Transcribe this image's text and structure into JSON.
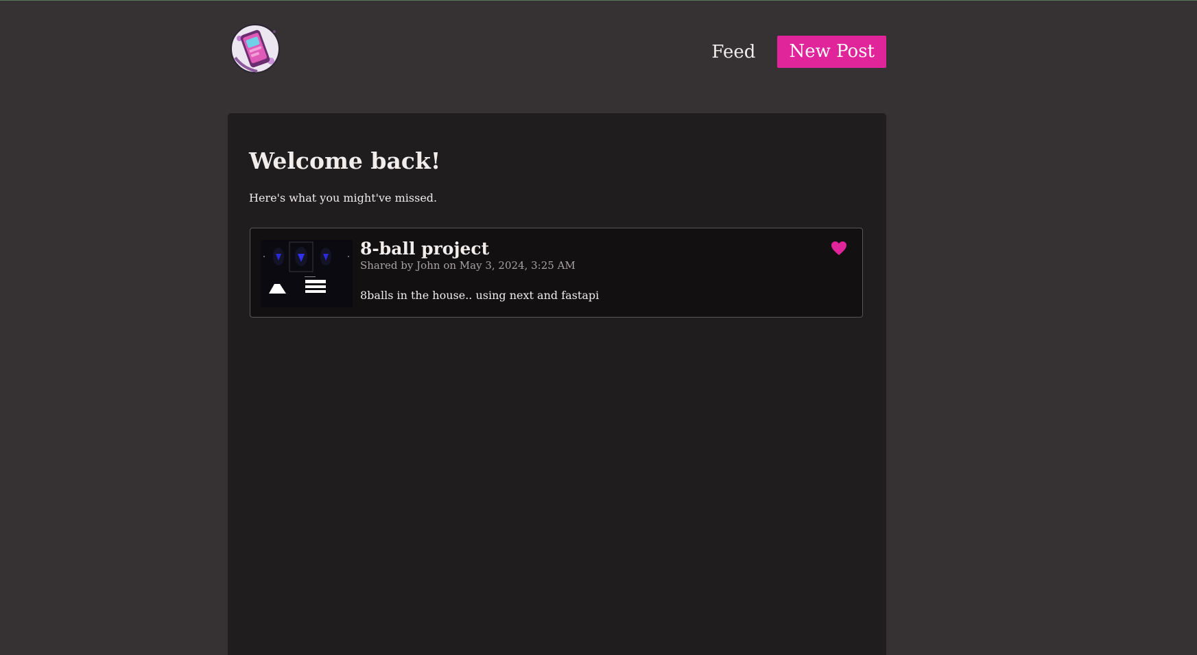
{
  "colors": {
    "background": "#363233",
    "card": "#201d1e",
    "post_card": "#121011",
    "accent": "#e0249a",
    "text": "#f2eded",
    "muted_text": "#a8a3a4"
  },
  "header": {
    "logo_icon": "phone-logo-icon",
    "nav": {
      "feed_label": "Feed",
      "new_post_label": "New Post"
    }
  },
  "main": {
    "title": "Welcome back!",
    "subtitle": "Here's what you might've missed.",
    "posts": [
      {
        "title": "8-ball project",
        "meta_prefix": "Shared by",
        "author": "John",
        "meta_on": "on",
        "date": "May 3, 2024, 3:25 AM",
        "body": "8balls in the house.. using next and fastapi",
        "thumbnail": "8-ball-project-screenshot",
        "like_icon": "heart-icon"
      }
    ]
  }
}
